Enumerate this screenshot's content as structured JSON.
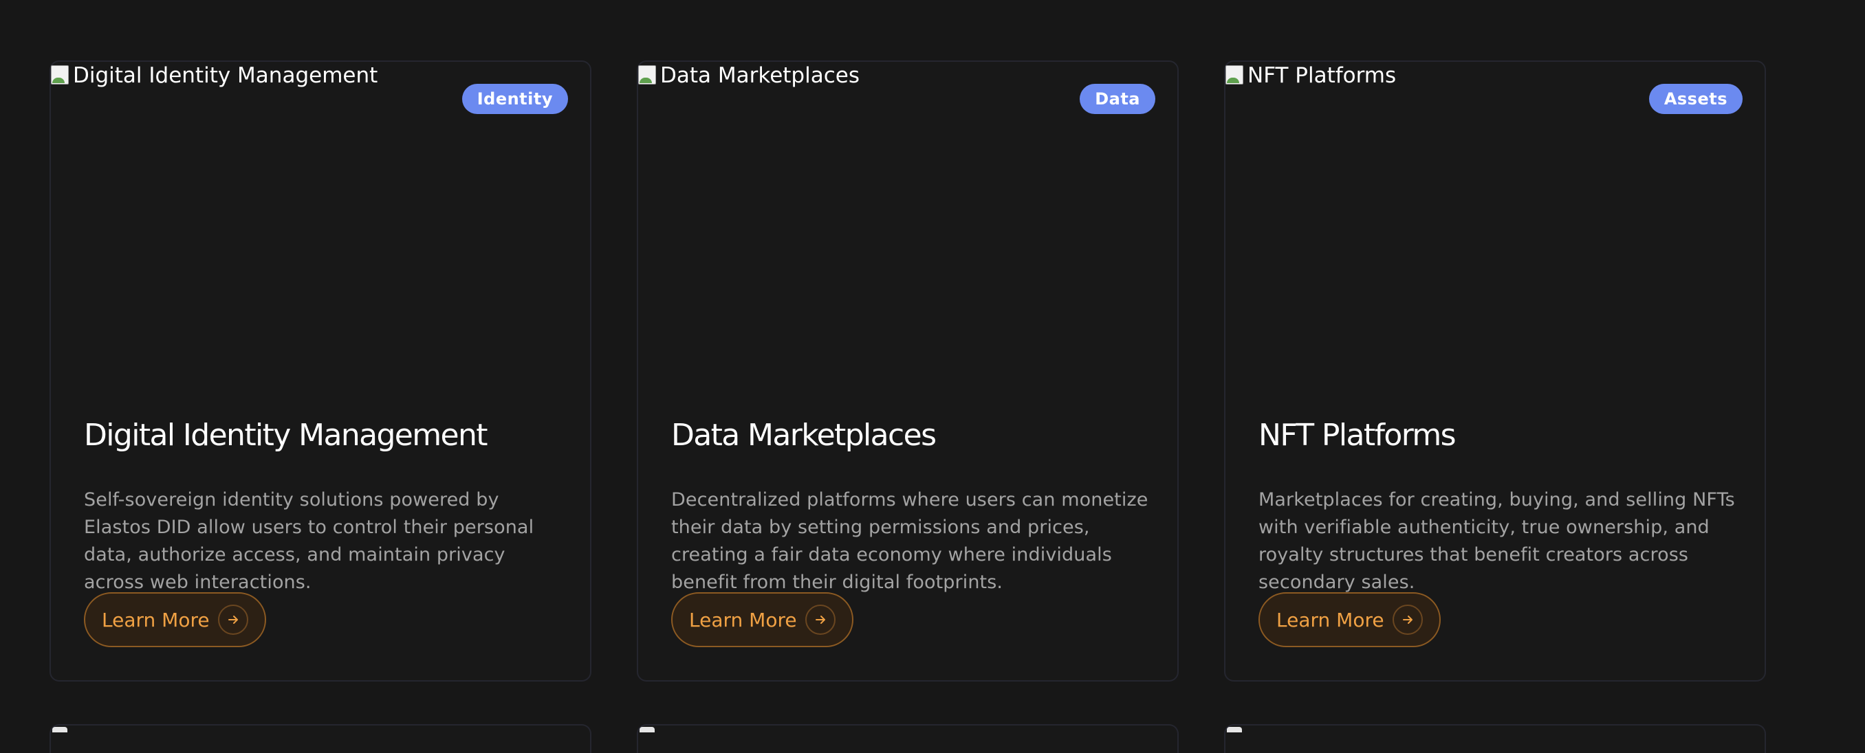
{
  "cards": [
    {
      "image_alt": "Digital Identity Management",
      "badge": "Identity",
      "title": "Digital Identity Management",
      "description": "Self-sovereign identity solutions powered by Elastos DID allow users to control their personal data, authorize access, and maintain privacy across web interactions.",
      "button_label": "Learn More"
    },
    {
      "image_alt": "Data Marketplaces",
      "badge": "Data",
      "title": "Data Marketplaces",
      "description": "Decentralized platforms where users can monetize their data by setting permissions and prices, creating a fair data economy where individuals benefit from their digital footprints.",
      "button_label": "Learn More"
    },
    {
      "image_alt": "NFT Platforms",
      "badge": "Assets",
      "title": "NFT Platforms",
      "description": "Marketplaces for creating, buying, and selling NFTs with verifiable authenticity, true ownership, and royalty structures that benefit creators across secondary sales.",
      "button_label": "Learn More"
    }
  ],
  "icons": {
    "broken_image": "broken-image-icon",
    "button_arrow": "arrow-right-icon"
  },
  "colors": {
    "background": "#171717",
    "card_border": "#25262f",
    "badge": "#6b8af0",
    "accent": "#f0a144",
    "title": "#ffffff",
    "description": "#a3a3a3"
  }
}
